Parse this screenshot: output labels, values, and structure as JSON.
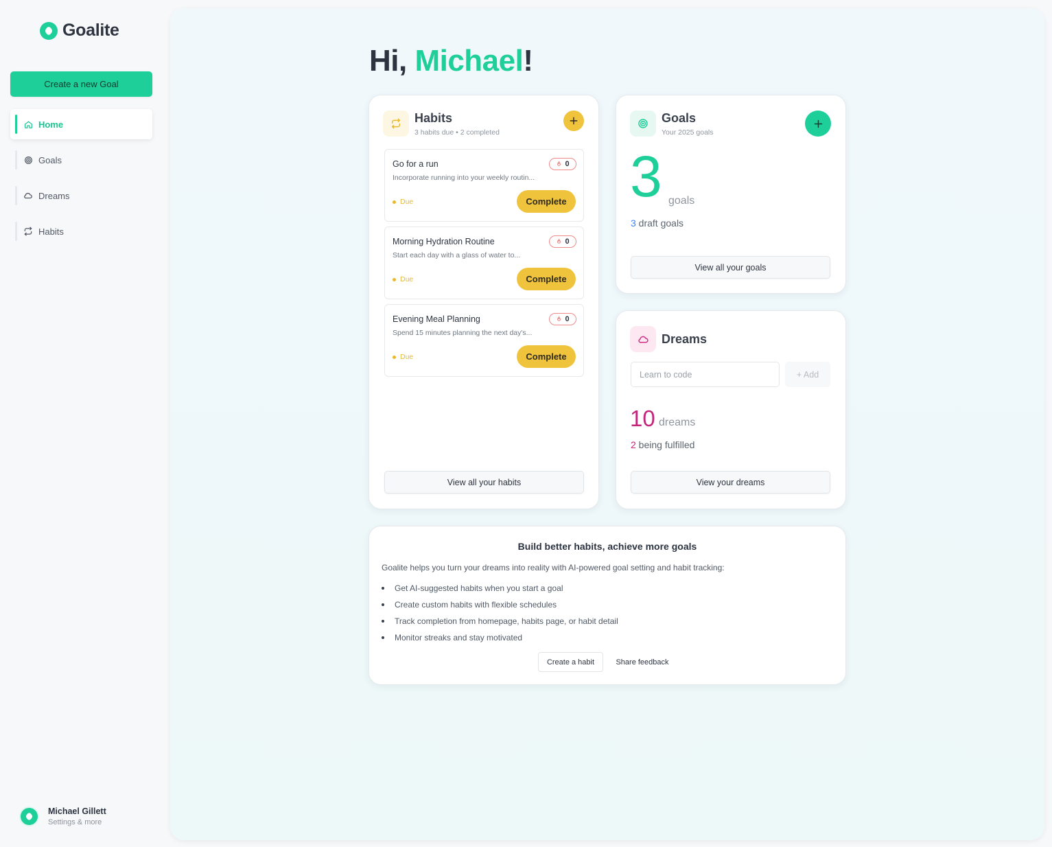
{
  "app": {
    "name": "Goalite"
  },
  "sidebar": {
    "create_goal_label": "Create a new Goal",
    "items": [
      {
        "label": "Home",
        "icon": "home-icon",
        "active": true
      },
      {
        "label": "Goals",
        "icon": "target-icon",
        "active": false
      },
      {
        "label": "Dreams",
        "icon": "cloud-icon",
        "active": false
      },
      {
        "label": "Habits",
        "icon": "repeat-icon",
        "active": false
      }
    ],
    "user": {
      "name": "Michael Gillett",
      "subtitle": "Settings & more"
    }
  },
  "greeting": {
    "prefix": "Hi, ",
    "name": "Michael",
    "suffix": "!"
  },
  "habits": {
    "title": "Habits",
    "subtitle": "3 habits due • 2 completed",
    "items": [
      {
        "name": "Go for a run",
        "description": "Incorporate running into your weekly routin...",
        "streak": "0",
        "status": "Due",
        "action": "Complete"
      },
      {
        "name": "Morning Hydration Routine",
        "description": "Start each day with a glass of water to...",
        "streak": "0",
        "status": "Due",
        "action": "Complete"
      },
      {
        "name": "Evening Meal Planning",
        "description": "Spend 15 minutes planning the next day's...",
        "streak": "0",
        "status": "Due",
        "action": "Complete"
      }
    ],
    "view_all_label": "View all your habits"
  },
  "goals": {
    "title": "Goals",
    "subtitle": "Your 2025 goals",
    "count": "3",
    "count_unit": "goals",
    "draft_count": "3",
    "draft_label": " draft goals",
    "view_all_label": "View all your goals"
  },
  "dreams": {
    "title": "Dreams",
    "input_placeholder": "Learn to code",
    "add_label": "Add",
    "count": "10",
    "count_unit": "dreams",
    "fulfilled_count": "2",
    "fulfilled_label": " being fulfilled",
    "view_all_label": "View your dreams"
  },
  "info": {
    "title": "Build better habits, achieve more goals",
    "text": "Goalite helps you turn your dreams into reality with AI-powered goal setting and habit tracking:",
    "bullets": [
      "Get AI-suggested habits when you start a goal",
      "Create custom habits with flexible schedules",
      "Track completion from homepage, habits page, or habit detail",
      "Monitor streaks and stay motivated"
    ],
    "create_habit_label": "Create a habit",
    "feedback_label": "Share feedback"
  },
  "colors": {
    "accent": "#1fcf9a",
    "habit_yellow": "#f0c33c",
    "dream_pink": "#c2257a",
    "goal_blue": "#3b82f6"
  }
}
